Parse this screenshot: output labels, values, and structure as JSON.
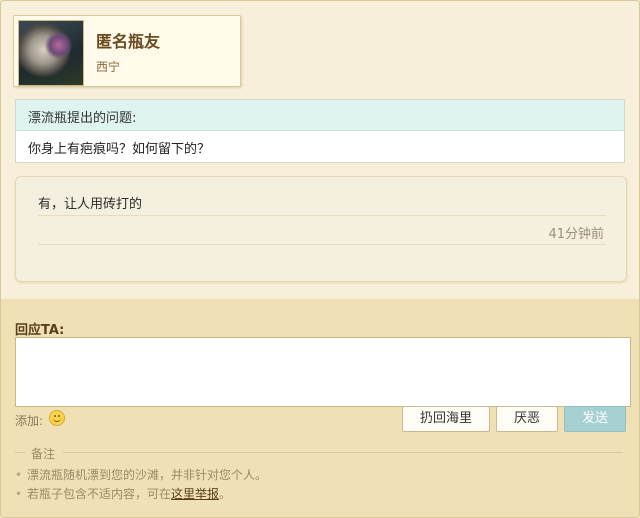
{
  "profile": {
    "name": "匿名瓶友",
    "location": "西宁",
    "avatar_icon": "avatar-image"
  },
  "question": {
    "title": "漂流瓶提出的问题:",
    "text": "你身上有疤痕吗？如何留下的？"
  },
  "answer": {
    "text": "有，让人用砖打的",
    "time": "41分钟前"
  },
  "reply": {
    "label": "回应TA:",
    "value": "",
    "add_label": "添加:",
    "emoji_icon": "smiley-icon"
  },
  "buttons": {
    "throw_back": "扔回海里",
    "dislike": "厌恶",
    "send": "发送"
  },
  "notes": {
    "title": "备注",
    "line1": "漂流瓶随机漂到您的沙滩，并非针对您个人。",
    "line2_prefix": "若瓶子包含不适内容，可在",
    "line2_link": "这里举报",
    "line2_suffix": "。"
  },
  "colors": {
    "send_button": "#a5cfd0",
    "question_header": "#dff3f1",
    "name_text": "#6a4a1f"
  }
}
